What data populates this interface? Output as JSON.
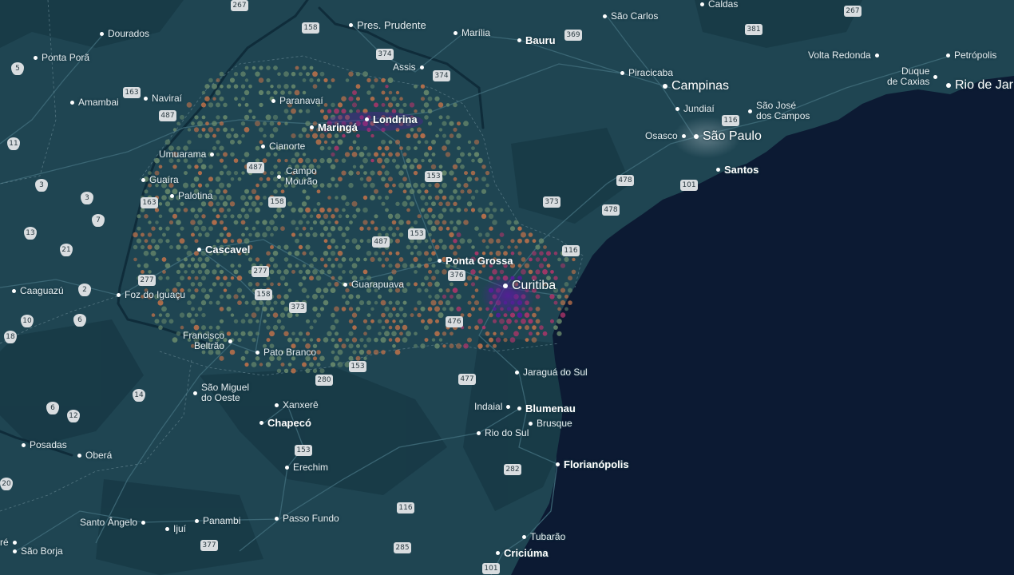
{
  "map": {
    "colors": {
      "land": "#1f4552",
      "land_dark": "#173845",
      "ocean": "#0c1a33",
      "road": "#3a6573",
      "hex_low": "#6a8a6c",
      "hex_mid": "#c0724a",
      "hex_high": "#b3356a",
      "hex_peak": "#5b1aa0"
    },
    "cities": [
      {
        "name": "Dourados",
        "tier": "minor"
      },
      {
        "name": "Ponta Porã",
        "tier": "minor"
      },
      {
        "name": "Amambai",
        "tier": "minor"
      },
      {
        "name": "Naviraí",
        "tier": "minor"
      },
      {
        "name": "Paranavaí",
        "tier": "minor"
      },
      {
        "name": "Maringá",
        "tier": "major"
      },
      {
        "name": "Londrina",
        "tier": "major"
      },
      {
        "name": "Cianorte",
        "tier": "minor"
      },
      {
        "name": "Umuarama",
        "tier": "minor"
      },
      {
        "name": "Campo\nMourão",
        "tier": "minor"
      },
      {
        "name": "Guaíra",
        "tier": "minor"
      },
      {
        "name": "Palotina",
        "tier": "minor"
      },
      {
        "name": "Cascavel",
        "tier": "major"
      },
      {
        "name": "Ponta Grossa",
        "tier": "major"
      },
      {
        "name": "Curitiba",
        "tier": "mega"
      },
      {
        "name": "Guarapuava",
        "tier": "minor"
      },
      {
        "name": "Foz do Iguaçu",
        "tier": "minor"
      },
      {
        "name": "Caaguazú",
        "tier": "minor"
      },
      {
        "name": "Francisco\nBeltrão",
        "tier": "minor"
      },
      {
        "name": "Pato Branco",
        "tier": "minor"
      },
      {
        "name": "São Miguel\ndo Oeste",
        "tier": "minor"
      },
      {
        "name": "Xanxerê",
        "tier": "minor"
      },
      {
        "name": "Chapecó",
        "tier": "major"
      },
      {
        "name": "Posadas",
        "tier": "minor"
      },
      {
        "name": "Oberá",
        "tier": "minor"
      },
      {
        "name": "Erechim",
        "tier": "minor"
      },
      {
        "name": "Santo Ângelo",
        "tier": "minor"
      },
      {
        "name": "Ijuí",
        "tier": "minor"
      },
      {
        "name": "Panambi",
        "tier": "minor"
      },
      {
        "name": "Passo Fundo",
        "tier": "minor"
      },
      {
        "name": "São Borja",
        "tier": "minor"
      },
      {
        "name": "Pres. Prudente",
        "tier": "minor"
      },
      {
        "name": "Marília",
        "tier": "minor"
      },
      {
        "name": "Bauru",
        "tier": "major"
      },
      {
        "name": "Assis",
        "tier": "minor"
      },
      {
        "name": "São Carlos",
        "tier": "minor"
      },
      {
        "name": "Piracicaba",
        "tier": "minor"
      },
      {
        "name": "Campinas",
        "tier": "mega"
      },
      {
        "name": "Jundiaí",
        "tier": "minor"
      },
      {
        "name": "São José\ndos Campos",
        "tier": "minor"
      },
      {
        "name": "Osasco",
        "tier": "minor"
      },
      {
        "name": "São Paulo",
        "tier": "mega"
      },
      {
        "name": "Santos",
        "tier": "major"
      },
      {
        "name": "Volta Redonda",
        "tier": "minor"
      },
      {
        "name": "Petrópolis",
        "tier": "minor"
      },
      {
        "name": "Duque\nde Caxias",
        "tier": "minor"
      },
      {
        "name": "Rio de Jar",
        "tier": "mega"
      },
      {
        "name": "Caldas",
        "tier": "minor"
      },
      {
        "name": "Jaraguá do Sul",
        "tier": "minor"
      },
      {
        "name": "Indaial",
        "tier": "minor"
      },
      {
        "name": "Blumenau",
        "tier": "major"
      },
      {
        "name": "Brusque",
        "tier": "minor"
      },
      {
        "name": "Rio do Sul",
        "tier": "minor"
      },
      {
        "name": "Florianópolis",
        "tier": "major"
      },
      {
        "name": "Tubarão",
        "tier": "minor"
      },
      {
        "name": "Criciúma",
        "tier": "major"
      },
      {
        "name": "ré",
        "tier": "minor"
      }
    ],
    "shields": [
      {
        "label": "267",
        "type": "fed"
      },
      {
        "label": "158",
        "type": "fed"
      },
      {
        "label": "374",
        "type": "fed"
      },
      {
        "label": "374",
        "type": "fed"
      },
      {
        "label": "369",
        "type": "fed"
      },
      {
        "label": "267",
        "type": "fed"
      },
      {
        "label": "381",
        "type": "fed"
      },
      {
        "label": "163",
        "type": "fed"
      },
      {
        "label": "487",
        "type": "fed"
      },
      {
        "label": "487",
        "type": "fed"
      },
      {
        "label": "153",
        "type": "fed"
      },
      {
        "label": "158",
        "type": "fed"
      },
      {
        "label": "163",
        "type": "fed"
      },
      {
        "label": "373",
        "type": "fed"
      },
      {
        "label": "478",
        "type": "fed"
      },
      {
        "label": "478",
        "type": "fed"
      },
      {
        "label": "116",
        "type": "fed"
      },
      {
        "label": "101",
        "type": "fed"
      },
      {
        "label": "487",
        "type": "fed"
      },
      {
        "label": "153",
        "type": "fed"
      },
      {
        "label": "116",
        "type": "fed"
      },
      {
        "label": "277",
        "type": "fed"
      },
      {
        "label": "277",
        "type": "fed"
      },
      {
        "label": "376",
        "type": "fed"
      },
      {
        "label": "158",
        "type": "fed"
      },
      {
        "label": "373",
        "type": "fed"
      },
      {
        "label": "476",
        "type": "fed"
      },
      {
        "label": "280",
        "type": "fed"
      },
      {
        "label": "153",
        "type": "fed"
      },
      {
        "label": "477",
        "type": "fed"
      },
      {
        "label": "153",
        "type": "fed"
      },
      {
        "label": "282",
        "type": "fed"
      },
      {
        "label": "116",
        "type": "fed"
      },
      {
        "label": "377",
        "type": "fed"
      },
      {
        "label": "285",
        "type": "fed"
      },
      {
        "label": "101",
        "type": "fed"
      },
      {
        "label": "5",
        "type": "state"
      },
      {
        "label": "11",
        "type": "state"
      },
      {
        "label": "3",
        "type": "state"
      },
      {
        "label": "3",
        "type": "state"
      },
      {
        "label": "7",
        "type": "state"
      },
      {
        "label": "13",
        "type": "state"
      },
      {
        "label": "21",
        "type": "state"
      },
      {
        "label": "2",
        "type": "state"
      },
      {
        "label": "10",
        "type": "state"
      },
      {
        "label": "6",
        "type": "state"
      },
      {
        "label": "18",
        "type": "state"
      },
      {
        "label": "14",
        "type": "state"
      },
      {
        "label": "6",
        "type": "state"
      },
      {
        "label": "12",
        "type": "state"
      },
      {
        "label": "20",
        "type": "state"
      }
    ]
  }
}
